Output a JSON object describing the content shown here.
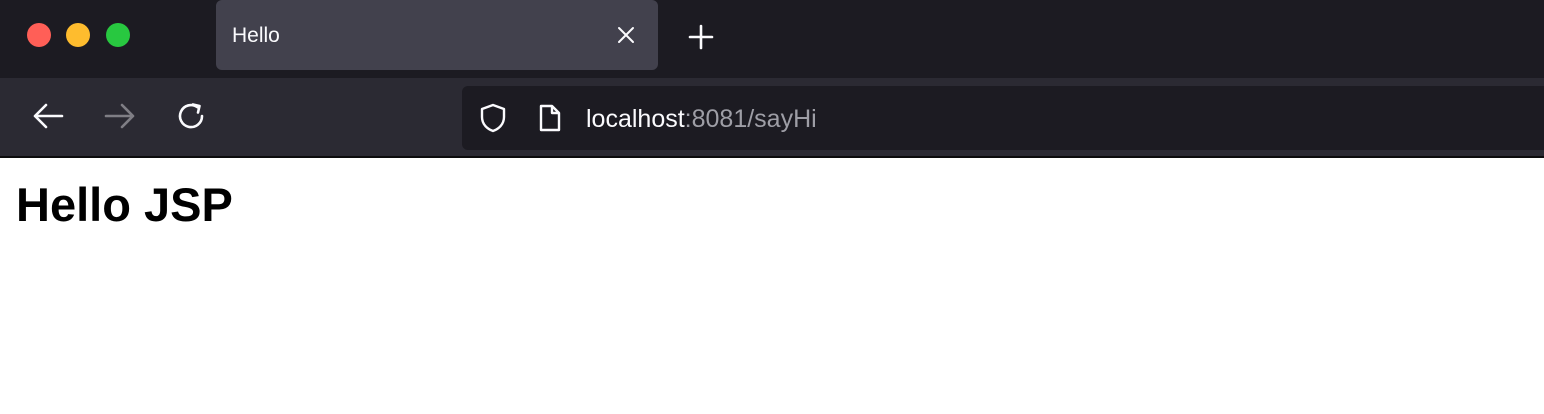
{
  "window": {
    "controls": [
      "close",
      "minimize",
      "maximize"
    ]
  },
  "tabs": [
    {
      "title": "Hello",
      "active": true
    }
  ],
  "tabstrip": {
    "new_tab_icon": "plus-icon",
    "close_tab_icon": "close-icon"
  },
  "navbar": {
    "back_icon": "arrow-left-icon",
    "forward_icon": "arrow-right-icon",
    "forward_enabled": false,
    "reload_icon": "reload-icon"
  },
  "urlbar": {
    "security_icon": "shield-icon",
    "page_icon": "page-icon",
    "host": "localhost",
    "rest": ":8081/sayHi"
  },
  "page": {
    "heading": "Hello JSP"
  },
  "colors": {
    "tabstrip_bg": "#1c1b22",
    "active_tab_bg": "#42414d",
    "navbar_bg": "#2b2a33",
    "urlbar_bg": "#1c1b22",
    "url_host": "#fbfbfe",
    "url_rest": "#9e9ea6",
    "traffic_close": "#ff5f57",
    "traffic_minimize": "#febc2e",
    "traffic_maximize": "#28c840"
  }
}
